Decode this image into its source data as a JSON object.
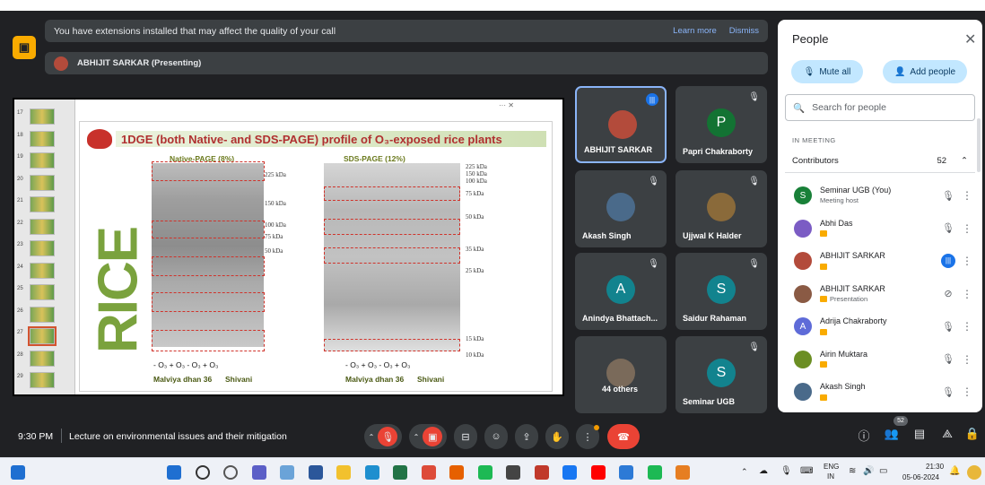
{
  "banner": {
    "message": "You have extensions installed that may affect the quality of your call",
    "learn_more": "Learn more",
    "dismiss": "Dismiss"
  },
  "presenting_bar": {
    "text": "ABHIJIT SARKAR (Presenting)"
  },
  "slide": {
    "title": "1DGE (both Native- and SDS-PAGE) profile of O₃-exposed rice plants",
    "side_word": "RICE",
    "native_label": "Native-PAGE (8%)",
    "sds_label": "SDS-PAGE (12%)",
    "native_markers": [
      "225 kDa",
      "150 kDa",
      "100 kDa",
      "75 kDa",
      "50 kDa"
    ],
    "sds_markers": [
      "225 kDa",
      "150 kDa",
      "100 kDa",
      "75 kDa",
      "50 kDa",
      "35 kDa",
      "25 kDa",
      "15 kDa",
      "10 kDa"
    ],
    "lanes_native": "- O₃  + O₃  - O₃  + O₃",
    "lanes_sds": "- O₃  + O₃  - O₃  + O₃",
    "variety_left": "Malviya dhan 36",
    "variety_right": "Shivani",
    "thumb_numbers": [
      "17",
      "18",
      "19",
      "20",
      "21",
      "22",
      "23",
      "24",
      "25",
      "26",
      "27",
      "28",
      "29"
    ]
  },
  "tiles": [
    {
      "name": "ABHIJIT SARKAR",
      "initial": "",
      "speaking": true
    },
    {
      "name": "Papri Chakraborty",
      "initial": "P",
      "muted": true
    },
    {
      "name": "Akash Singh",
      "initial": "",
      "muted": true
    },
    {
      "name": "Ujjwal K Halder",
      "initial": "",
      "muted": true
    },
    {
      "name": "Anindya Bhattach...",
      "initial": "A",
      "muted": true
    },
    {
      "name": "Saidur Rahaman",
      "initial": "S",
      "muted": true
    },
    {
      "name": "44 others",
      "initial": ""
    },
    {
      "name": "Seminar UGB",
      "initial": "S",
      "muted": true
    }
  ],
  "people_panel": {
    "title": "People",
    "mute_all": "Mute all",
    "add_people": "Add people",
    "search_placeholder": "Search for people",
    "in_meeting": "IN MEETING",
    "contributors_label": "Contributors",
    "contributors_count": "52",
    "people": [
      {
        "name": "Seminar UGB (You)",
        "sub": "Meeting host",
        "initial": "S",
        "color": "#188038",
        "status": "muted"
      },
      {
        "name": "Abhi Das",
        "sub": "",
        "initial": "",
        "color": "#7b5cc4",
        "status": "muted"
      },
      {
        "name": "ABHIJIT SARKAR",
        "sub": "",
        "initial": "",
        "color": "#b34b3b",
        "status": "speaking"
      },
      {
        "name": "ABHIJIT SARKAR",
        "sub": "Presentation",
        "initial": "",
        "color": "#8a5a44",
        "status": "presenting"
      },
      {
        "name": "Adrija Chakraborty",
        "sub": "",
        "initial": "A",
        "color": "#5e6bd8",
        "status": "muted"
      },
      {
        "name": "Airin Muktara",
        "sub": "",
        "initial": "",
        "color": "#6b8e23",
        "status": "muted"
      },
      {
        "name": "Akash Singh",
        "sub": "",
        "initial": "",
        "color": "#4a6a8a",
        "status": "muted"
      }
    ]
  },
  "bottom_bar": {
    "time": "9:30 PM",
    "meeting_title": "Lecture on environmental issues and their mitigation",
    "people_badge": "52"
  },
  "taskbar": {
    "language": "ENG",
    "region": "IN",
    "clock_time": "21:30",
    "clock_date": "05-06-2024"
  }
}
